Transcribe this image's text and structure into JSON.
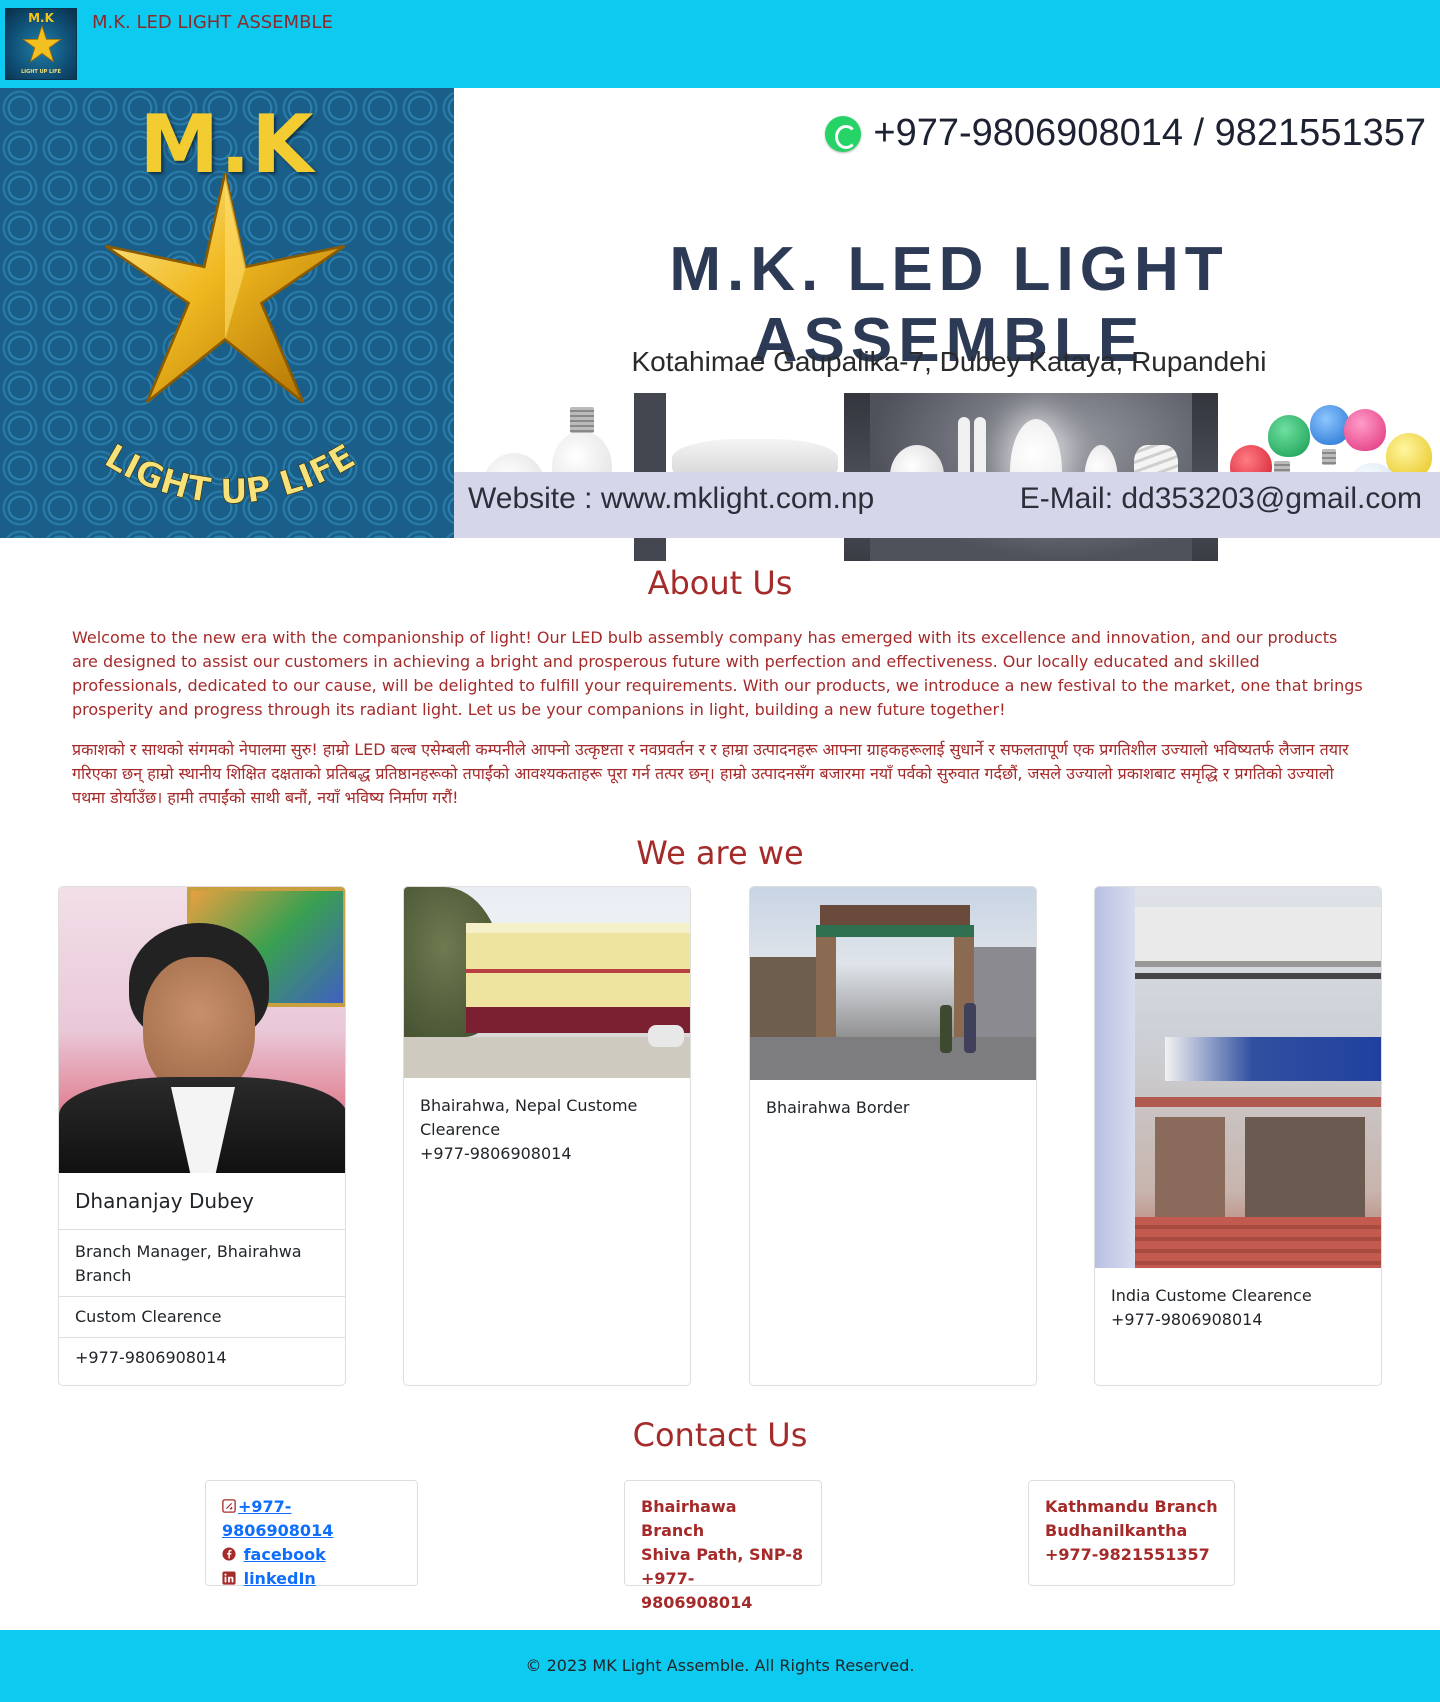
{
  "header": {
    "title": "M.K. LED LIGHT ASSEMBLE",
    "logo_initials": "M.K",
    "logo_tagline": "LIGHT UP LIFE"
  },
  "banner": {
    "logo_initials": "M.K",
    "tagline": "LIGHT UP LIFE",
    "phone": "+977-9806908014 / 9821551357",
    "company_name": "M.K. LED LIGHT ASSEMBLE",
    "address": "Kotahimae Gaupalika-7, Dubey Kataya, Rupandehi",
    "website": "Website : www.mklight.com.np",
    "email": "E-Mail: dd353203@gmail.com"
  },
  "about": {
    "title": "About Us",
    "english": "Welcome to the new era with the companionship of light! Our LED bulb assembly company has emerged with its excellence and innovation, and our products are designed to assist our customers in achieving a bright and prosperous future with perfection and effectiveness. Our locally educated and skilled professionals, dedicated to our cause, will be delighted to fulfill your requirements. With our products, we introduce a new festival to the market, one that brings prosperity and progress through its radiant light. Let us be your companions in light, building a new future together!",
    "nepali": "प्रकाशको र साथको संगमको नेपालमा सुरु! हाम्रो LED बल्ब एसेम्बली कम्पनीले आफ्नो उत्कृष्टता र नवप्रवर्तन र र हाम्रा उत्पादनहरू आफ्ना ग्राहकहरूलाई सुधार्ने र सफलतापूर्ण एक प्रगतिशील उज्यालो भविष्यतर्फ लैजान तयार गरिएका छन् हाम्रो स्थानीय शिक्षित दक्षताको प्रतिबद्ध प्रतिष्ठानहरूको तपाईंको आवश्यकताहरू पूरा गर्न तत्पर छन्। हाम्रो उत्पादनसँग बजारमा नयाँ पर्वको सुरुवात गर्दछौं, जसले उज्यालो प्रकाशबाट समृद्धि र प्रगतिको उज्यालो पथमा डोर्याउँछ। हामी तपाईंको साथी बनौं, नयाँ भविष्य निर्माण गरौं!"
  },
  "team": {
    "title": "We are we",
    "cards": [
      {
        "name": "Dhananjay Dubey",
        "role": "Branch Manager, Bhairahwa Branch",
        "dept": "Custom Clearence",
        "phone": "+977-9806908014"
      },
      {
        "text": "Bhairahwa, Nepal Custome Clearence",
        "phone": "+977-9806908014"
      },
      {
        "text": "Bhairahwa Border"
      },
      {
        "text": "India Custome Clearence",
        "phone": "+977-9806908014"
      }
    ]
  },
  "contact": {
    "title": "Contact Us",
    "links": {
      "phone": "+977-9806908014",
      "facebook": "facebook",
      "linkedin": "linkedIn"
    },
    "bhairahwa": {
      "name": "Bhairhawa Branch",
      "address": "Shiva Path, SNP-8",
      "phone": "+977-9806908014"
    },
    "kathmandu": {
      "name": "Kathmandu Branch",
      "address": "Budhanilkantha",
      "phone": "+977-9821551357"
    }
  },
  "footer": {
    "text": "© 2023 MK Light Assemble. All Rights Reserved."
  },
  "colors": {
    "topbar": "#0dcaf0",
    "accent": "#a52a2a",
    "link": "#0d6efd"
  },
  "icons": [
    "whatsapp-icon",
    "phone-square-icon",
    "facebook-icon",
    "linkedin-icon",
    "star-logo-icon"
  ]
}
